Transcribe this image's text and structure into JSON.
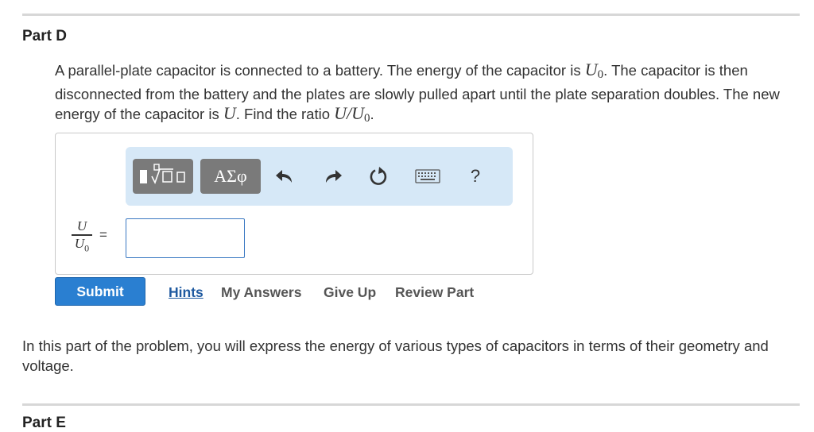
{
  "part": {
    "title": "Part D"
  },
  "question": {
    "text_1": "A parallel-plate capacitor is connected to a battery. The energy of the capacitor is ",
    "u0_symbol": "U",
    "u0_subscript": "0",
    "text_2": ". The capacitor is then disconnected from the battery and the plates are slowly pulled apart until the plate separation doubles. The new energy of the capacitor is ",
    "u_symbol": "U",
    "text_3": ". Find the ratio ",
    "ratio_expression": "U/U",
    "ratio_subscript": "0",
    "text_4": "."
  },
  "toolbar": {
    "greek_label": "ΑΣφ",
    "help_label": "?",
    "icons": [
      "templates-icon",
      "greek-symbols-icon",
      "undo-icon",
      "redo-icon",
      "reset-icon",
      "keyboard-icon",
      "help-icon"
    ]
  },
  "answer": {
    "fraction_numerator": "U",
    "fraction_denominator": "U",
    "fraction_denominator_subscript": "0",
    "equals": "=",
    "input_value": ""
  },
  "actions": {
    "submit_label": "Submit",
    "hints_label": "Hints",
    "my_answers_label": "My Answers",
    "give_up_label": "Give Up",
    "review_part_label": "Review Part"
  },
  "intro": {
    "text": "In this part of the problem, you will express the energy of various types of capacitors in terms of their geometry and voltage."
  },
  "next_part": {
    "title": "Part E"
  },
  "colors": {
    "submit_bg": "#2a7fd1",
    "toolbar_bg": "#d6e8f7",
    "link_blue": "#1f5aa0",
    "input_border": "#3a78c2"
  }
}
